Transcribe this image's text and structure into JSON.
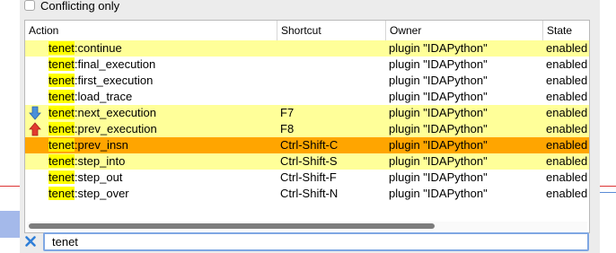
{
  "filter": {
    "conflicting_label": "Conflicting only",
    "query": "tenet"
  },
  "columns": {
    "action": "Action",
    "shortcut": "Shortcut",
    "owner": "Owner",
    "state": "State"
  },
  "rows": [
    {
      "prefix": "tenet",
      "suffix": ":continue",
      "shortcut": "",
      "owner": "plugin \"IDAPython\"",
      "state": "enabled"
    },
    {
      "prefix": "tenet",
      "suffix": ":final_execution",
      "shortcut": "",
      "owner": "plugin \"IDAPython\"",
      "state": "enabled"
    },
    {
      "prefix": "tenet",
      "suffix": ":first_execution",
      "shortcut": "",
      "owner": "plugin \"IDAPython\"",
      "state": "enabled"
    },
    {
      "prefix": "tenet",
      "suffix": ":load_trace",
      "shortcut": "",
      "owner": "plugin \"IDAPython\"",
      "state": "enabled"
    },
    {
      "prefix": "tenet",
      "suffix": ":next_execution",
      "shortcut": "F7",
      "owner": "plugin \"IDAPython\"",
      "state": "enabled"
    },
    {
      "prefix": "tenet",
      "suffix": ":prev_execution",
      "shortcut": "F8",
      "owner": "plugin \"IDAPython\"",
      "state": "enabled"
    },
    {
      "prefix": "tenet",
      "suffix": ":prev_insn",
      "shortcut": "Ctrl-Shift-C",
      "owner": "plugin \"IDAPython\"",
      "state": "enabled"
    },
    {
      "prefix": "tenet",
      "suffix": ":step_into",
      "shortcut": "Ctrl-Shift-S",
      "owner": "plugin \"IDAPython\"",
      "state": "enabled"
    },
    {
      "prefix": "tenet",
      "suffix": ":step_out",
      "shortcut": "Ctrl-Shift-F",
      "owner": "plugin \"IDAPython\"",
      "state": "enabled"
    },
    {
      "prefix": "tenet",
      "suffix": ":step_over",
      "shortcut": "Ctrl-Shift-N",
      "owner": "plugin \"IDAPython\"",
      "state": "enabled"
    }
  ],
  "colors": {
    "highlight": "#ffff99",
    "selected": "#ffa500",
    "match": "#ffff00",
    "down_arrow": "#4a90d9",
    "up_arrow": "#e23b2e",
    "clear_icon": "#2f7fd8"
  }
}
